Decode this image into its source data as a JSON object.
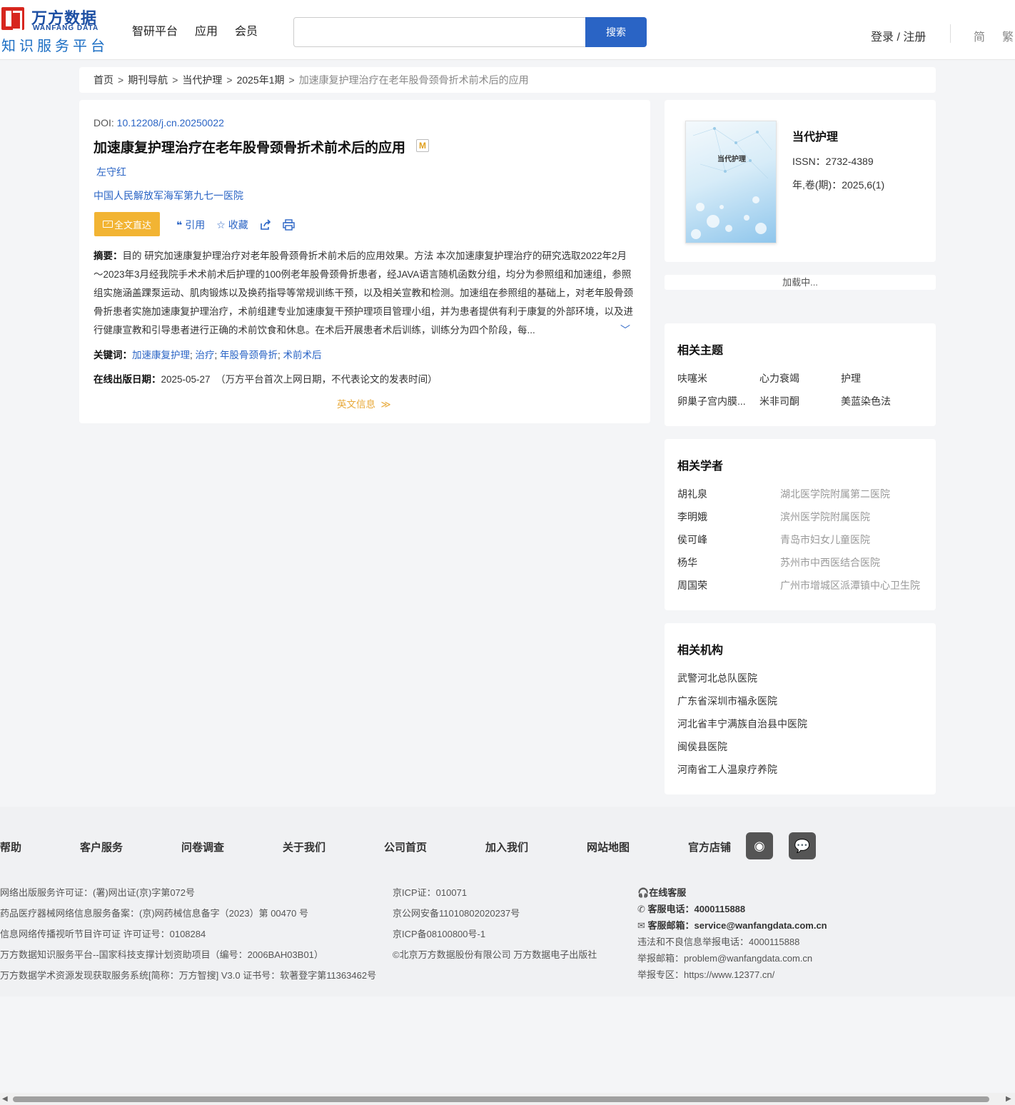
{
  "header": {
    "logo_cn": "万方数据",
    "logo_en": "WANFANG DATA",
    "logo_sub": "知识服务平台",
    "nav": [
      "智研平台",
      "应用",
      "会员"
    ],
    "search_placeholder": "",
    "search_button": "搜索",
    "login": "登录 / 注册",
    "lang_simplified": "简",
    "lang_traditional": "繁"
  },
  "breadcrumb": {
    "items": [
      "首页",
      "期刊导航",
      "当代护理",
      "2025年1期"
    ],
    "separator": ">",
    "current": "加速康复护理治疗在老年股骨颈骨折术前术后的应用"
  },
  "article": {
    "doi_label": "DOI: ",
    "doi": "10.12208/j.cn.20250022",
    "title": "加速康复护理治疗在老年股骨颈骨折术前术后的应用",
    "badge": "M",
    "author": "左守红",
    "organization": "中国人民解放军海军第九七一医院",
    "fulltext_button": "全文直达",
    "actions": {
      "cite": "引用",
      "favorite": "收藏"
    },
    "abstract_label": "摘要：",
    "abstract": "目的 研究加速康复护理治疗对老年股骨颈骨折术前术后的应用效果。方法 本次加速康复护理治疗的研究选取2022年2月～2023年3月经我院手术术前术后护理的100例老年股骨颈骨折患者，经JAVA语言随机函数分组，均分为参照组和加速组，参照组实施涵盖踝泵运动、肌肉锻炼以及换药指导等常规训练干预，以及相关宣教和检测。加速组在参照组的基础上，对老年股骨颈骨折患者实施加速康复护理治疗，术前组建专业加速康复干预护理项目管理小组，并为患者提供有利于康复的外部环境，以及进行健康宣教和引导患者进行正确的术前饮食和休息。在术后开展患者术后训练，训练分为四个阶段，每...",
    "keywords_label": "关键词：",
    "keywords": [
      "加速康复护理",
      "治疗",
      "年股骨颈骨折",
      "术前术后"
    ],
    "pubdate_label": "在线出版日期：",
    "pubdate": "2025-05-27",
    "pubdate_note": "（万方平台首次上网日期，不代表论文的发表时间）",
    "english_info": "英文信息"
  },
  "journal": {
    "cover_title": "当代护理",
    "name": "当代护理",
    "issn": "ISSN：2732-4389",
    "volume": "年,卷(期)：2025,6(1)"
  },
  "loading": "加载中...",
  "topics": {
    "title": "相关主题",
    "items": [
      "呋噻米",
      "心力衰竭",
      "护理",
      "卵巢子宫内膜...",
      "米非司酮",
      "美蓝染色法"
    ]
  },
  "scholars": {
    "title": "相关学者",
    "items": [
      {
        "name": "胡礼泉",
        "org": "湖北医学院附属第二医院"
      },
      {
        "name": "李明娥",
        "org": "滨州医学院附属医院"
      },
      {
        "name": "侯可峰",
        "org": "青岛市妇女儿童医院"
      },
      {
        "name": "杨华",
        "org": "苏州市中西医结合医院"
      },
      {
        "name": "周国荣",
        "org": "广州市增城区派潭镇中心卫生院"
      }
    ]
  },
  "institutions": {
    "title": "相关机构",
    "items": [
      "武警河北总队医院",
      "广东省深圳市福永医院",
      "河北省丰宁满族自治县中医院",
      "闽侯县医院",
      "河南省工人温泉疗养院"
    ]
  },
  "footer": {
    "links": [
      "帮助",
      "客户服务",
      "问卷调查",
      "关于我们",
      "公司首页",
      "加入我们",
      "网站地图",
      "官方店铺"
    ],
    "col1": [
      "网络出版服务许可证：(署)网出证(京)字第072号",
      "药品医疗器械网络信息服务备案：(京)网药械信息备字（2023）第 00470 号",
      "信息网络传播视听节目许可证 许可证号：0108284",
      "万方数据知识服务平台--国家科技支撑计划资助项目（编号：2006BAH03B01）",
      "万方数据学术资源发现获取服务系统[简称：万方智搜] V3.0 证书号：软著登字第11363462号"
    ],
    "col2": [
      "京ICP证：010071",
      "京公网安备11010802020237号",
      "京ICP备08100800号-1",
      "©北京万方数据股份有限公司 万方数据电子出版社"
    ],
    "online_service": "在线客服",
    "phone_label": "客服电话：",
    "phone": "4000115888",
    "email_label": "客服邮箱：",
    "email": "service@wanfangdata.com.cn",
    "report_phone": "违法和不良信息举报电话：4000115888",
    "report_email": "举报邮箱：problem@wanfangdata.com.cn",
    "report_area": "举报专区：https://www.12377.cn/"
  },
  "colors": {
    "primary": "#2a64c5",
    "brand_red": "#d7261e",
    "fulltext": "#f2b433",
    "english_info": "#e8a93a"
  }
}
